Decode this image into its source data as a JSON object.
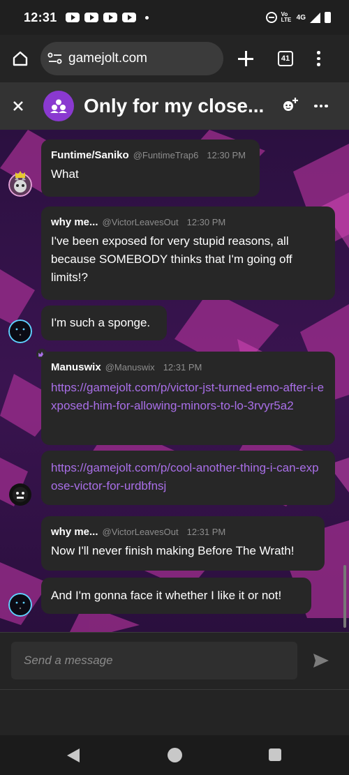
{
  "status_bar": {
    "time": "12:31",
    "network": "4G",
    "volte": "Vo LTE",
    "notification_icons": [
      "youtube-icon",
      "youtube-icon",
      "youtube-icon",
      "youtube-icon"
    ]
  },
  "browser": {
    "url": "gamejolt.com",
    "tab_count": "41"
  },
  "chat": {
    "title": "Only for my close...",
    "accent_color": "#8a39d0",
    "link_color": "#a96fe8",
    "messages": [
      {
        "user": "Funtime/Saniko",
        "handle": "@FuntimeTrap6",
        "time": "12:30 PM",
        "text": "What"
      },
      {
        "user": "why me...",
        "handle": "@VictorLeavesOut",
        "time": "12:30 PM",
        "text": "I've been exposed for very stupid reasons, all because SOMEBODY thinks that I'm going off limits!?",
        "followups": [
          "I'm such a sponge."
        ]
      },
      {
        "user": "Manuswix",
        "handle": "@Manuswix",
        "time": "12:31 PM",
        "link": "https://gamejolt.com/p/victor-jst-turned-emo-after-i-exposed-him-for-allowing-minors-to-lo-3rvyr5a2",
        "followups": [
          "https://gamejolt.com/p/cool-another-thing-i-can-expose-victor-for-urdbfnsj"
        ]
      },
      {
        "user": "why me...",
        "handle": "@VictorLeavesOut",
        "time": "12:31 PM",
        "text": "Now I'll never finish making Before The Wrath!",
        "followups": [
          "And I'm gonna face it whether I like it or not!"
        ]
      }
    ]
  },
  "composer": {
    "placeholder": "Send a message"
  }
}
